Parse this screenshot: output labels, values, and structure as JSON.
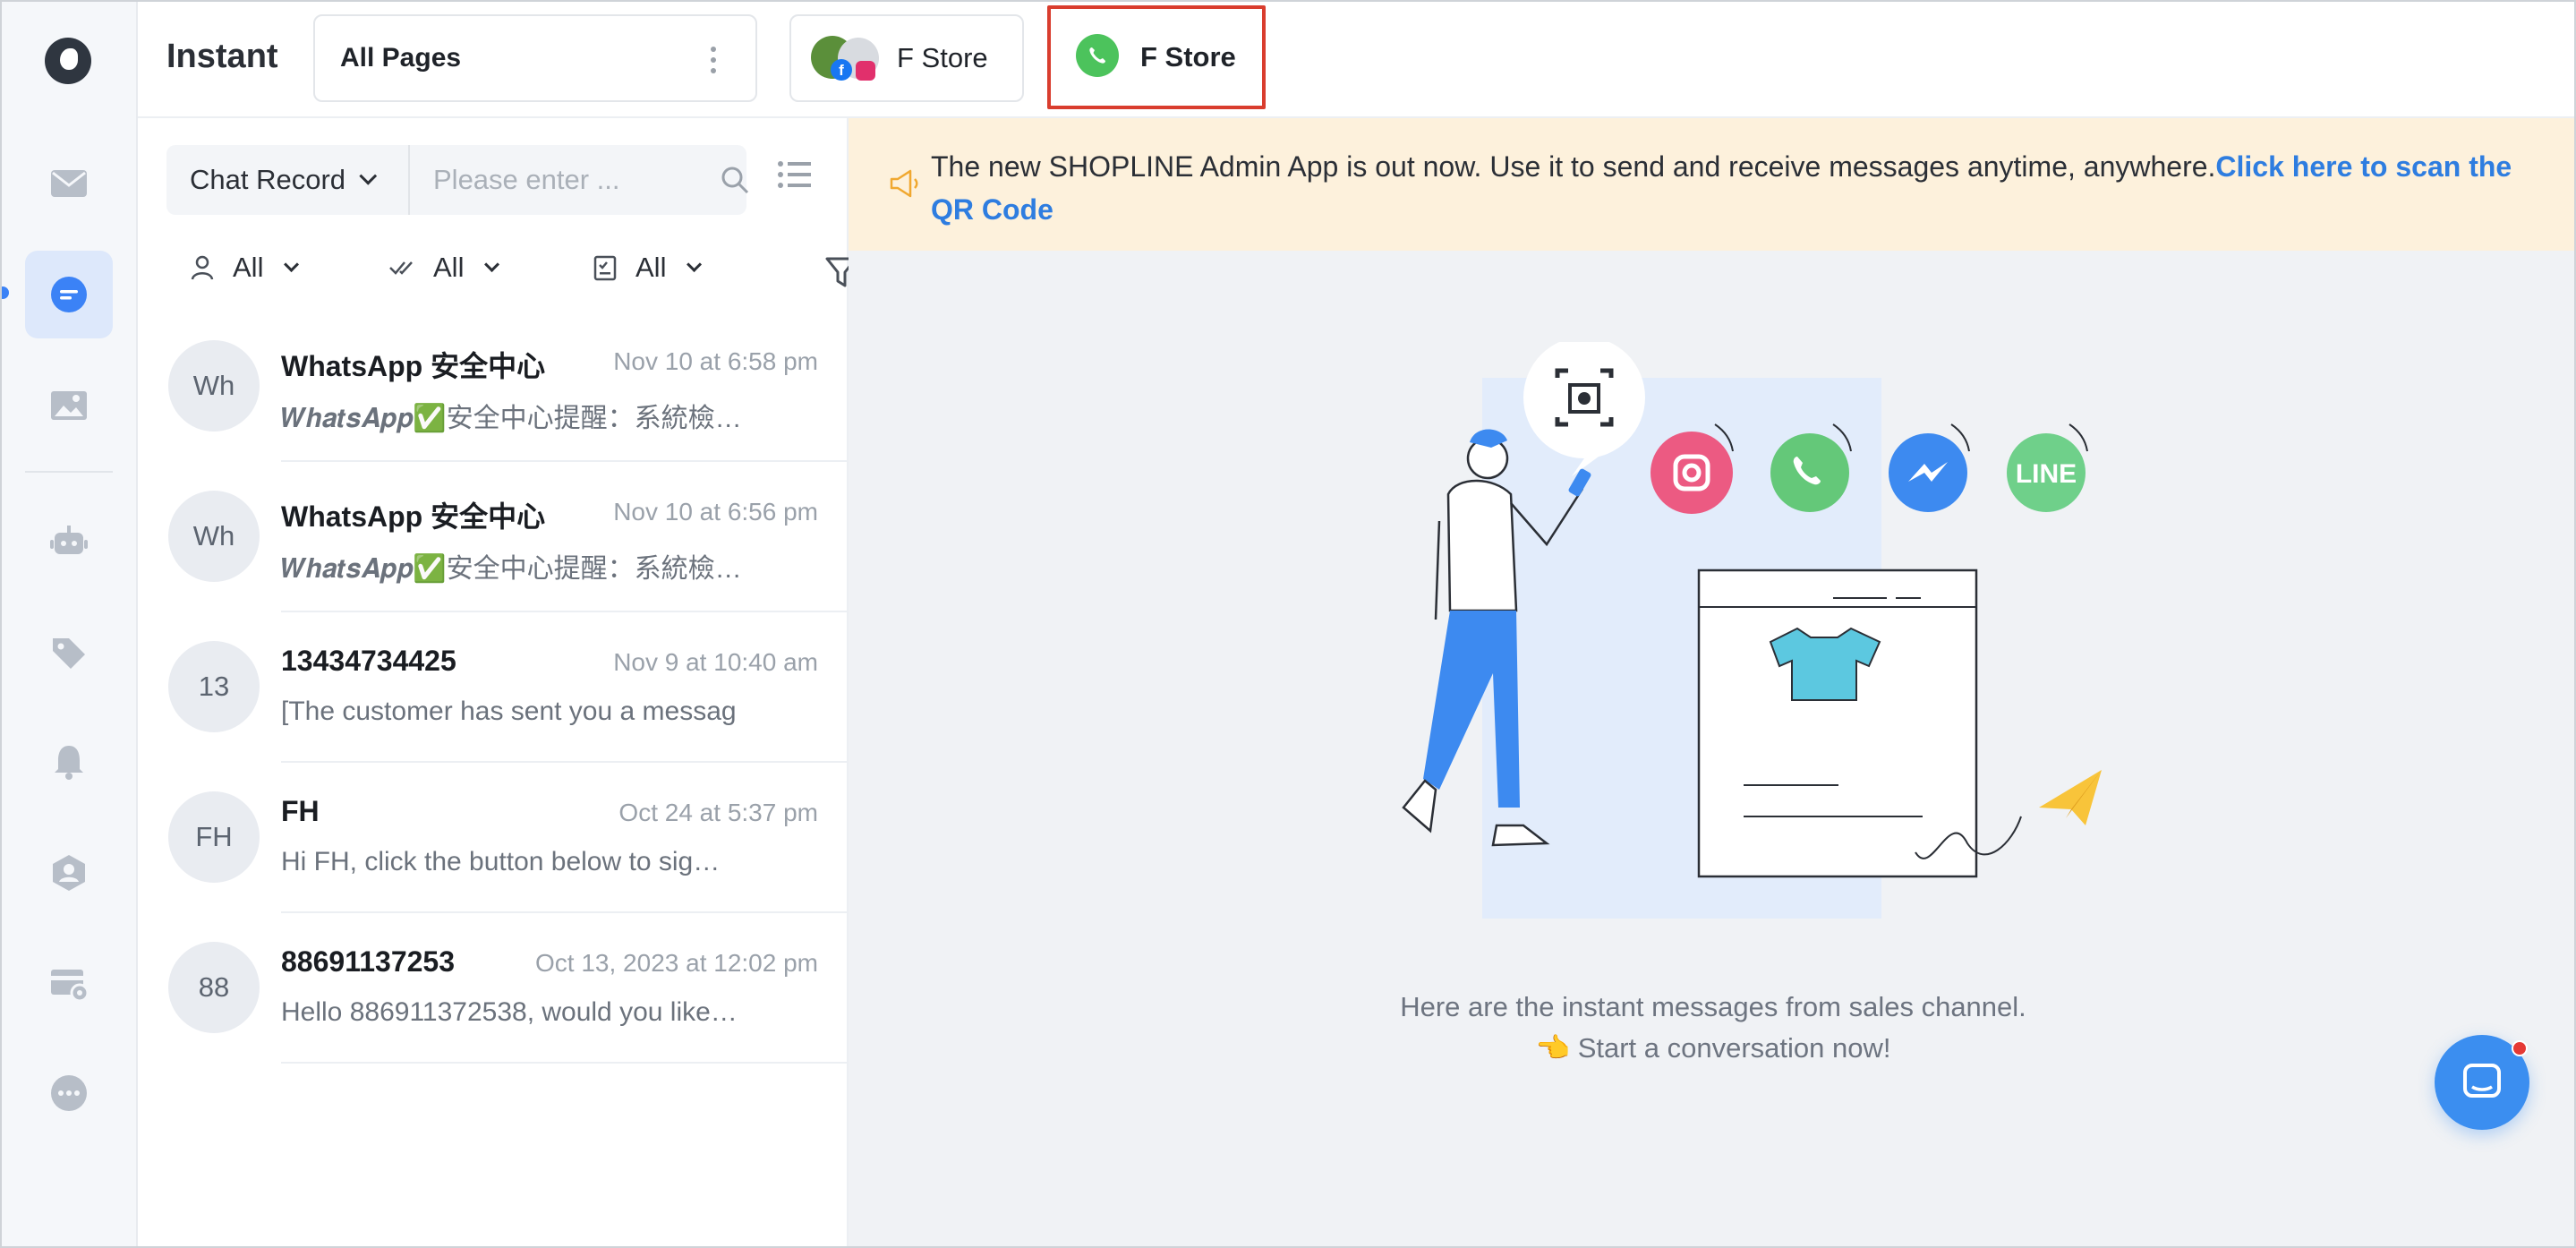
{
  "app": {
    "title": "Instant"
  },
  "header": {
    "pages_select": "All Pages",
    "store_tabs": [
      {
        "label": "F Store",
        "channels": [
          "facebook-icon",
          "instagram-icon"
        ]
      },
      {
        "label": "F Store",
        "channels": [
          "whatsapp-icon"
        ],
        "selected": true
      }
    ]
  },
  "sidebar": {
    "items": [
      {
        "icon": "inbox-icon"
      },
      {
        "icon": "chat-icon",
        "active": true
      },
      {
        "icon": "image-icon"
      },
      {
        "icon": "robot-icon"
      },
      {
        "icon": "tag-icon"
      },
      {
        "icon": "bell-icon"
      },
      {
        "icon": "agent-icon"
      },
      {
        "icon": "broadcast-icon"
      },
      {
        "icon": "more-icon"
      }
    ]
  },
  "list": {
    "record_select": "Chat Record",
    "search_placeholder": "Please enter ...",
    "filters": {
      "assignee": "All",
      "read": "All",
      "status": "All"
    },
    "conversations": [
      {
        "avatar": "Wh",
        "name": "WhatsApp 安全中心",
        "time": "Nov 10 at 6:58 pm",
        "preview_prefix": "𝑾𝒉𝒂𝒕𝒔𝑨𝒑𝒑",
        "preview": "✅安全中心提醒：系統檢…"
      },
      {
        "avatar": "Wh",
        "name": "WhatsApp 安全中心",
        "time": "Nov 10 at 6:56 pm",
        "preview_prefix": "𝑾𝒉𝒂𝒕𝒔𝑨𝒑𝒑",
        "preview": "✅安全中心提醒：系統檢…"
      },
      {
        "avatar": "13",
        "name": "13434734425",
        "time": "Nov 9 at 10:40 am",
        "preview_prefix": "",
        "preview": "[The customer has sent you a messag"
      },
      {
        "avatar": "FH",
        "name": "FH",
        "time": "Oct 24 at 5:37 pm",
        "preview_prefix": "",
        "preview": "Hi FH, click the button below to sig…"
      },
      {
        "avatar": "88",
        "name": "88691137253",
        "time": "Oct 13, 2023 at 12:02 pm",
        "preview_prefix": "",
        "preview": "Hello 886911372538, would you like…"
      }
    ]
  },
  "notice": {
    "text": "The new SHOPLINE Admin App is out now. Use it to send and receive messages anytime, anywhere.",
    "link": "Click here to scan the QR Code"
  },
  "empty_state": {
    "line1": "Here are the instant messages from sales channel.",
    "line2": "👈 Start a conversation now!",
    "channel_icons": [
      "instagram-icon",
      "whatsapp-icon",
      "messenger-icon",
      "line-icon"
    ],
    "line_label": "LINE"
  },
  "colors": {
    "accent": "#3b8ef0",
    "notice_bg": "#fdf1dc",
    "link": "#2e7de0",
    "highlight_border": "#d93d2e"
  }
}
